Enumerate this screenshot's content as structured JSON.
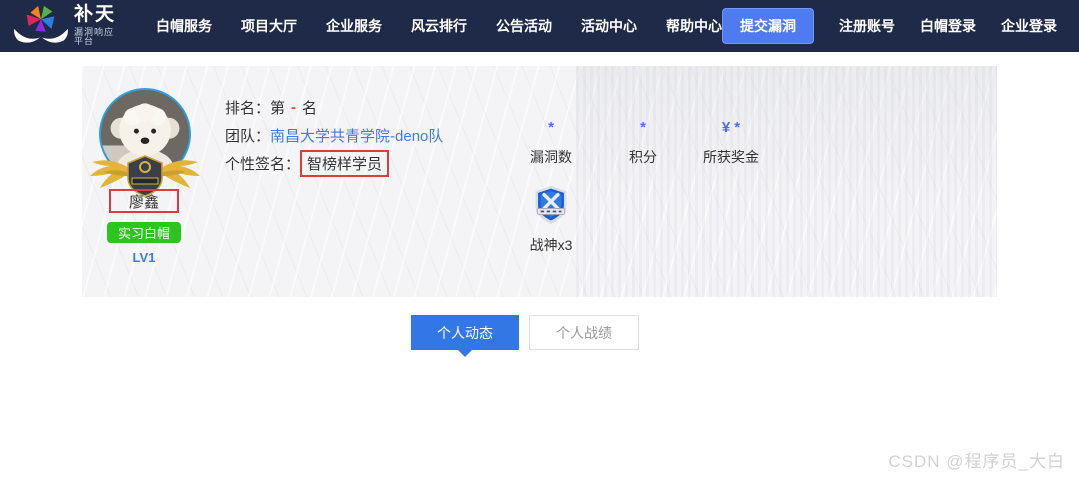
{
  "navbar": {
    "logo": {
      "icon": "butian-star-hands-logo",
      "title": "补天",
      "subtitle": "漏洞响应平台"
    },
    "links": [
      {
        "label": "白帽服务"
      },
      {
        "label": "项目大厅"
      },
      {
        "label": "企业服务"
      },
      {
        "label": "风云排行"
      },
      {
        "label": "公告活动"
      },
      {
        "label": "活动中心"
      },
      {
        "label": "帮助中心"
      }
    ],
    "submit_button_label": "提交漏洞",
    "auth_links": [
      {
        "label": "注册账号"
      },
      {
        "label": "白帽登录"
      },
      {
        "label": "企业登录"
      }
    ]
  },
  "profile": {
    "avatar_icon": "dog-photo-avatar",
    "avatar_badge_icon": "golden-wings-badge",
    "name": "廖鑫",
    "role_badge": "实习白帽",
    "level": "LV1",
    "rank": {
      "label": "排名：",
      "prefix": "第",
      "value": "-",
      "suffix": "名"
    },
    "team": {
      "label": "团队：",
      "name": "南昌大学共青学院-deno队"
    },
    "signature": {
      "label": "个性签名：",
      "value": "智榜样学员"
    },
    "stats": [
      {
        "value": "*",
        "label": "漏洞数"
      },
      {
        "value": "*",
        "label": "积分"
      },
      {
        "currency": "¥",
        "value": "*",
        "label": "所获奖金"
      }
    ],
    "medal": {
      "icon": "war-god-shield-badge",
      "label": "战神x3"
    }
  },
  "tabs": [
    {
      "label": "个人动态",
      "active": true
    },
    {
      "label": "个人战绩",
      "active": false
    }
  ],
  "watermark": "CSDN @程序员_大白",
  "colors": {
    "navbar_bg": "#1e2a48",
    "accent_blue": "#4e7cf0",
    "link_blue": "#3d7af0",
    "badge_green": "#2cc41f",
    "annotation_red": "#e03a3a",
    "tab_active_blue": "#3377e6",
    "stat_value_blue": "#4d6bf0"
  }
}
